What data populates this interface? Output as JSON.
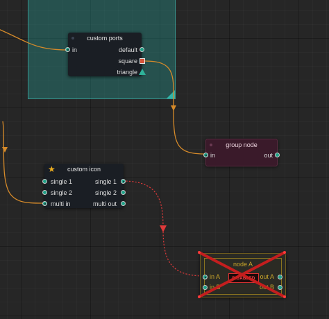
{
  "group": {
    "resize_icon": "resize-corner-icon"
  },
  "custom_ports_node": {
    "title": "custom ports",
    "input_in": "in",
    "out_default": "default",
    "out_square": "square",
    "out_triangle": "triangle"
  },
  "group_node": {
    "title": "group node",
    "input_in": "in",
    "output_out": "out"
  },
  "custom_icon_node": {
    "title": "custom icon",
    "icon": "star-icon",
    "in_single_1": "single 1",
    "in_single_2": "single 2",
    "in_multi": "multi in",
    "out_single_1": "single 1",
    "out_single_2": "single 2",
    "out_multi": "multi out"
  },
  "node_a": {
    "title": "node A",
    "badge": "DISABLED",
    "in_a": "in A",
    "in_b": "in B",
    "out_a": "out A",
    "out_b": "out B"
  },
  "colors": {
    "wire": "#d58a2a",
    "wire_dashed": "#e03a3a",
    "port_fill": "#1fa187",
    "group_fill": "#26aaa0",
    "group_node_bg": "#3a1a2a",
    "disabled_accent": "#c8a52a",
    "disabled_x": "#c41e1e"
  }
}
